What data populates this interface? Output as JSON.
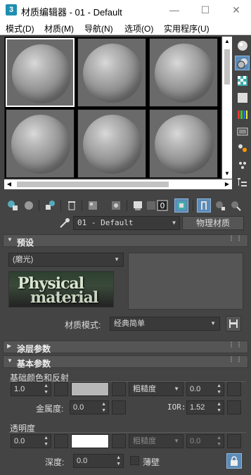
{
  "window": {
    "app_icon": "3",
    "title": "材质编辑器 - 01 - Default",
    "minimize": "—",
    "maximize": "☐",
    "close": "✕"
  },
  "menu": [
    "模式(D)",
    "材质(M)",
    "导航(N)",
    "选项(O)",
    "实用程序(U)"
  ],
  "name_row": {
    "material_name": "01 - Default",
    "type_button": "物理材质"
  },
  "rollouts": {
    "presets": {
      "title": "预设",
      "preset_value": "(磨光)",
      "mode_label": "材质模式:",
      "mode_value": "经典简单",
      "logo_line1": "Physical",
      "logo_line2": "material"
    },
    "coating": {
      "title": "涂层参数"
    },
    "basic": {
      "title": "基本参数",
      "base_section": "基础颜色和反射",
      "base_weight": "1.0",
      "roughness_mode": "粗糙度",
      "roughness": "0.0",
      "metalness_label": "金属度:",
      "metalness": "0.0",
      "ior_label": "IOR:",
      "ior": "1.52",
      "transparency_section": "透明度",
      "trans_weight": "0.0",
      "trans_roughness_mode": "粗糙度",
      "trans_roughness": "0.0",
      "depth_label": "深度:",
      "depth": "0.0",
      "thin_label": "薄壁"
    }
  },
  "colors": {
    "base_color": "#b8b8b8",
    "trans_color": "#ffffff",
    "accent": "#5b8bb8"
  }
}
